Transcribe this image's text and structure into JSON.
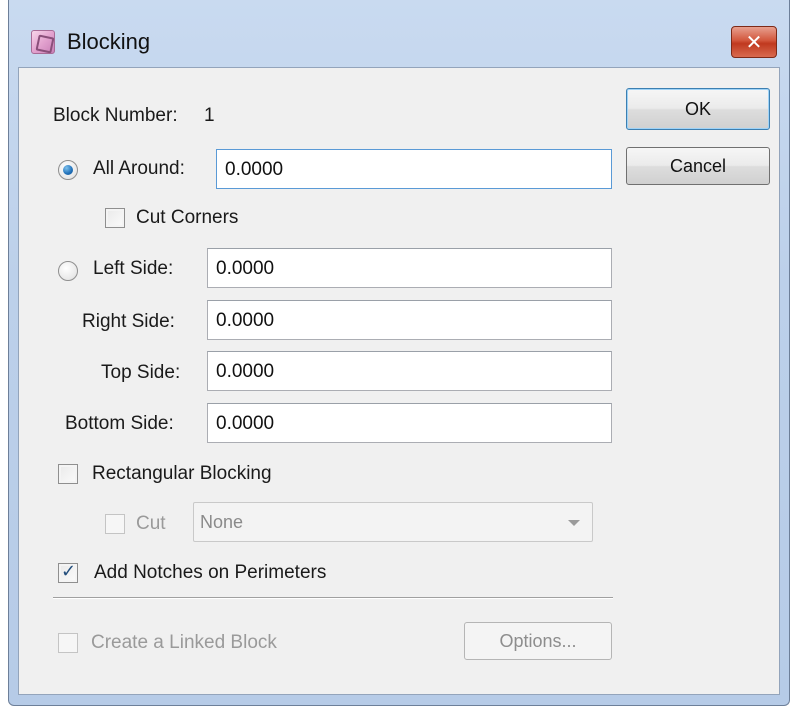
{
  "window": {
    "title": "Blocking",
    "close_glyph": "✕"
  },
  "block_number": {
    "label": "Block Number:",
    "value": "1"
  },
  "buttons": {
    "ok": "OK",
    "cancel": "Cancel",
    "options": "Options..."
  },
  "all_around": {
    "label": "All Around:",
    "value": "0.0000",
    "selected": true
  },
  "cut_corners": {
    "label": "Cut Corners",
    "checked": false
  },
  "left_side": {
    "label": "Left Side:",
    "value": "0.0000",
    "selected": false
  },
  "right_side": {
    "label": "Right Side:",
    "value": "0.0000"
  },
  "top_side": {
    "label": "Top Side:",
    "value": "0.0000"
  },
  "bottom_side": {
    "label": "Bottom Side:",
    "value": "0.0000"
  },
  "rectangular_blocking": {
    "label": "Rectangular Blocking",
    "checked": false
  },
  "cut": {
    "label": "Cut",
    "checked": false,
    "enabled": false,
    "selected_option": "None"
  },
  "add_notches": {
    "label": "Add Notches on Perimeters",
    "checked": true,
    "check_glyph": "✓"
  },
  "linked_block": {
    "label": "Create a Linked Block",
    "checked": false,
    "enabled": false
  },
  "icons": {
    "app": "blocking-app-icon",
    "close": "close-icon",
    "dropdown": "chevron-down-icon"
  }
}
